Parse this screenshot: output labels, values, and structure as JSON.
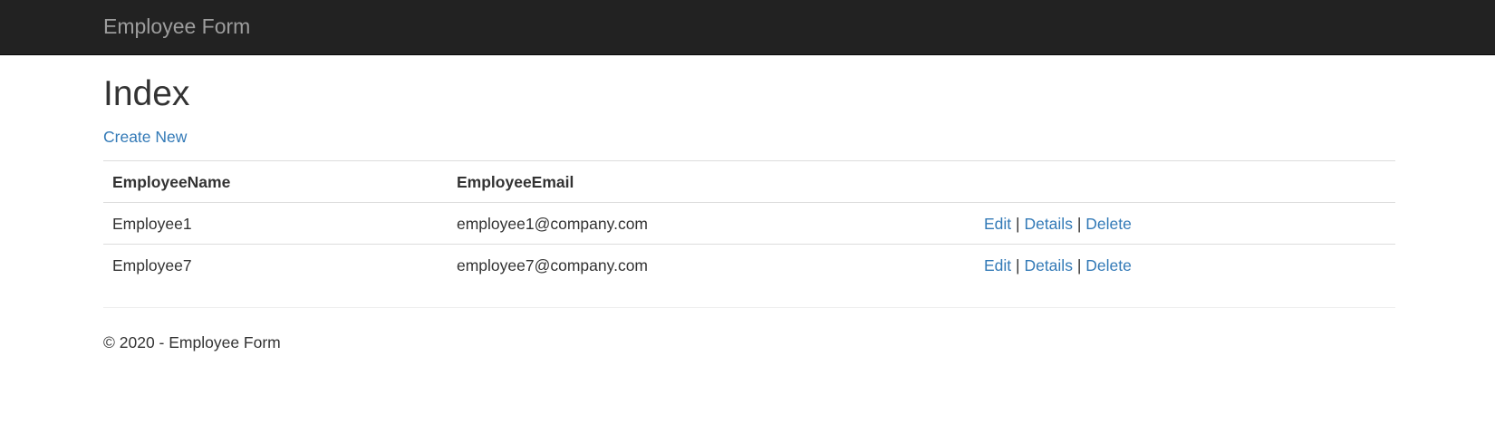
{
  "navbar": {
    "brand": "Employee Form"
  },
  "page": {
    "title": "Index",
    "create_new": "Create New"
  },
  "table": {
    "headers": [
      "EmployeeName",
      "EmployeeEmail",
      ""
    ],
    "rows": [
      {
        "name": "Employee1",
        "email": "employee1@company.com",
        "edit": "Edit",
        "details": "Details",
        "delete": "Delete"
      },
      {
        "name": "Employee7",
        "email": "employee7@company.com",
        "edit": "Edit",
        "details": "Details",
        "delete": "Delete"
      }
    ],
    "separator": "|"
  },
  "footer": {
    "text": "© 2020 - Employee Form"
  },
  "colors": {
    "navbar_bg": "#222222",
    "brand": "#9d9d9d",
    "link": "#337ab7",
    "text": "#333333"
  }
}
